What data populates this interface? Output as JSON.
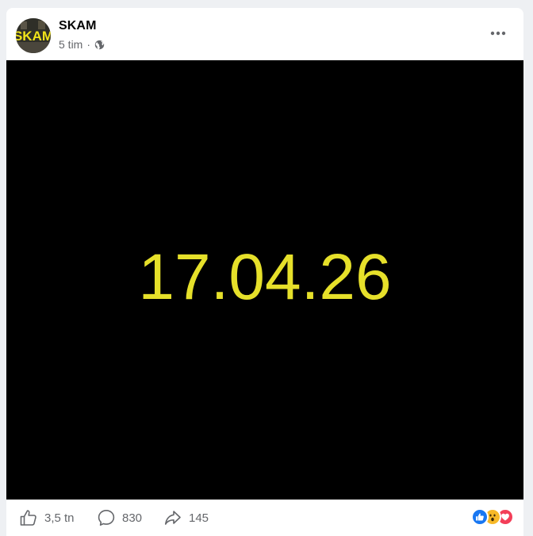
{
  "post": {
    "page_name": "SKAM",
    "avatar_text": "SKAM",
    "time": "5 tim",
    "separator": "·",
    "media_text": "17.04.26"
  },
  "footer": {
    "likes": "3,5 tn",
    "comments": "830",
    "shares": "145"
  },
  "colors": {
    "media_background": "#000000",
    "media_text": "#e6e02a",
    "like_blue": "#1877f2",
    "wow_yellow": "#f7b928",
    "love_red": "#f33e58"
  },
  "icons": {
    "visibility": "globe-icon",
    "more": "more-options-icon",
    "like": "thumbs-up-icon",
    "comment": "comment-icon",
    "share": "share-icon"
  }
}
